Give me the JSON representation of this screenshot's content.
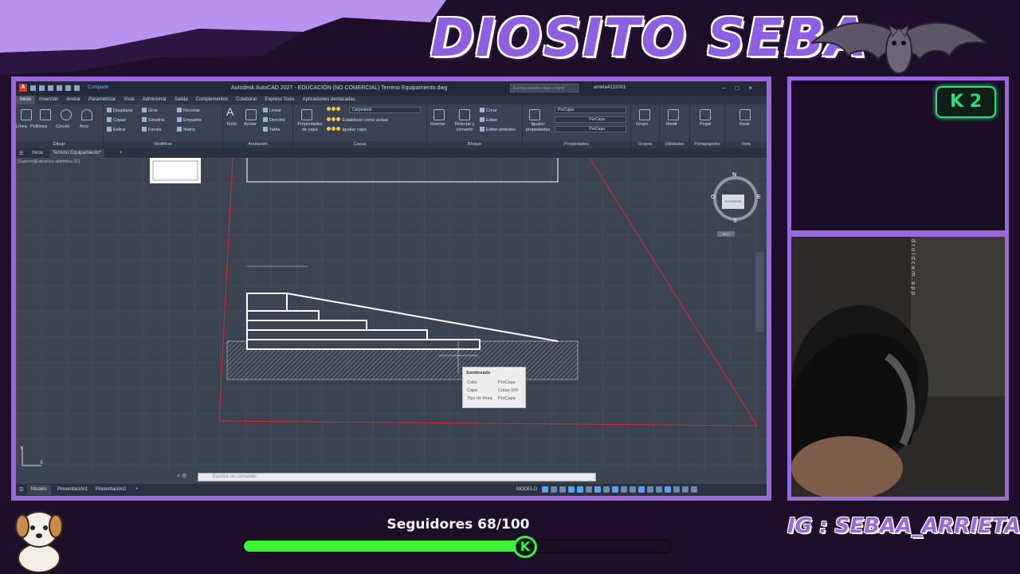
{
  "overlay": {
    "channel_title": "DIOSITO SEBA",
    "ig_handle": "IG : SEBAA_ARRIETA",
    "followers_label": "Seguidores 68/100",
    "followers_current": 68,
    "followers_goal": 100,
    "kick_badge": "K 2",
    "kick_knob": "K",
    "droidcam_label": "droidcam.app",
    "accent_color": "#9a6ad8",
    "progress_color": "#3cf23a"
  },
  "autocad": {
    "title": "Autodesk AutoCAD 2027 - EDUCACIÓN (NO COMERCIAL)   Terreno Equipamiento.dwg",
    "share": "Compartir",
    "search_placeholder": "Escriba palabra clave o frase",
    "user": "arrieta4122001",
    "menu": [
      "Inicio",
      "Inserción",
      "Anotar",
      "Parametrizar",
      "Vista",
      "Administrar",
      "Salida",
      "Complementos",
      "Colaborar",
      "Express Tools",
      "Aplicaciones destacadas"
    ],
    "ribbon": {
      "dibujo": {
        "title": "Dibujo",
        "items": [
          "Línea",
          "Polilínea",
          "Círculo",
          "Arco"
        ]
      },
      "modificar": {
        "title": "Modificar",
        "items": [
          "Desplazar",
          "Girar",
          "Recortar",
          "Copiar",
          "Simetría",
          "Empalme",
          "Estirar",
          "Escala",
          "Matriz"
        ]
      },
      "anotacion": {
        "title": "Anotación",
        "items": [
          "Texto",
          "Acotar",
          "Lineal",
          "Directriz",
          "Tabla"
        ]
      },
      "capas": {
        "title": "Capas",
        "items": [
          "Propiedades de capa",
          "Establecer como actual",
          "Igualar capa"
        ],
        "current_layer": "Carpinteria"
      },
      "bloque": {
        "title": "Bloque",
        "items": [
          "Insertar",
          "Detectar y convertir",
          "Crear",
          "Editar",
          "Editar atributos"
        ]
      },
      "propiedades": {
        "title": "Propiedades",
        "items": [
          "Igualar propiedades"
        ],
        "color": "PorCapa",
        "linetype": "PorCapa",
        "lineweight": "PorCapa"
      },
      "grupos": {
        "title": "Grupos",
        "items": [
          "Grupo"
        ]
      },
      "utilidades": {
        "title": "Utilidades",
        "items": [
          "Medir"
        ]
      },
      "portapapeles": {
        "title": "Portapapeles",
        "items": [
          "Pegar"
        ]
      },
      "vista": {
        "title": "Vista",
        "items": [
          "Base"
        ]
      }
    },
    "doc_tabs": [
      "Inicio",
      "Terreno Equipamiento*"
    ],
    "view_label": "[Superior][Estructura alámbrica 2D]",
    "viewcube": {
      "top": "SUPERIOR",
      "n": "N",
      "s": "S",
      "e": "E",
      "o": "O",
      "wcs": "SCU"
    },
    "tooltip": {
      "title": "Sombreado",
      "rows": [
        {
          "k": "Color",
          "v": "PorCapa"
        },
        {
          "k": "Capa",
          "v": "Cotas-100"
        },
        {
          "k": "Tipo de línea",
          "v": "PorCapa"
        }
      ]
    },
    "command_placeholder": "Escriba un comando",
    "layout_tabs": [
      "Modelo",
      "Presentación1",
      "Presentación2"
    ],
    "status_mode": "MODELO"
  }
}
